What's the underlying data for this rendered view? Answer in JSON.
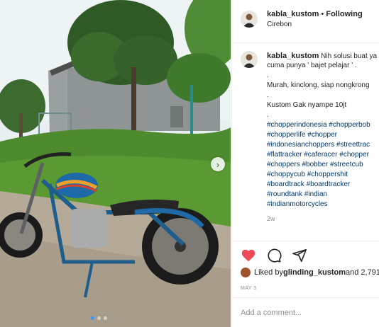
{
  "post": {
    "username": "kabla_kustom",
    "follow_separator": " • ",
    "follow_label": "Following",
    "location": "Cirebon",
    "image_alt": "custom chopper motorcycle with blue tank",
    "carousel": {
      "count": 3,
      "active": 1
    }
  },
  "caption": {
    "username": "kabla_kustom",
    "lines": [
      "Nih solusi buat ya",
      "cuma punya ' bajet pelajar ' .",
      ".",
      "Murah, kinclong, siap nongkrong",
      ".",
      "Kustom Gak nyampe 10jt",
      "."
    ],
    "hashtags": [
      "#chopperindonesia #chopperbob",
      "#chopperlife #chopper",
      "#indonesianchoppers #streettrac",
      "#flattracker #caferacer #chopper",
      "#choppers #bobber #streetcub",
      "#choppycub #choppershit",
      "#boardtrack #boardtracker",
      "#roundtank #indian",
      "#indianmotorcycles"
    ],
    "time": "2w"
  },
  "likes": {
    "prefix": "Liked by ",
    "user": "glinding_kustom",
    "suffix": " and 2,791"
  },
  "date": "MAY 3",
  "comment_placeholder": "Add a comment...",
  "colors": {
    "like": "#ed4956",
    "hashtag": "#00376b",
    "muted": "#8e8e8e"
  },
  "icons": {
    "like": "heart-icon",
    "comment": "comment-icon",
    "share": "share-icon",
    "next": "chevron-right-icon"
  }
}
